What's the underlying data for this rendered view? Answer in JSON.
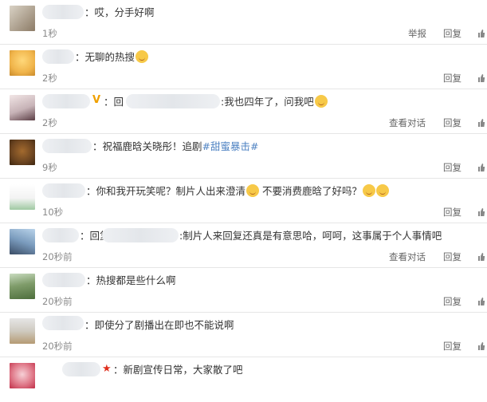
{
  "comments": [
    {
      "text": "：哎，分手好啊",
      "time": "1秒",
      "report": "举报",
      "reply": "回复"
    },
    {
      "text": "：无聊的热搜",
      "time": "2秒",
      "reply": "回复"
    },
    {
      "prefix": "：回",
      "text": ":我也四年了，问我吧",
      "time": "2秒",
      "view": "查看对话",
      "reply": "回复"
    },
    {
      "text": "：祝福鹿晗关晓彤！追剧",
      "hashtag": "#甜蜜暴击#",
      "time": "9秒",
      "reply": "回复"
    },
    {
      "text": "：你和我开玩笑呢？制片人出来澄清",
      "text2": "不要消费鹿晗了好吗？",
      "time": "10秒",
      "reply": "回复"
    },
    {
      "prefix": "：回复",
      "text": ":制片人来回复还真是有意思哈，呵呵，这事属于个人事情吧",
      "time": "20秒前",
      "view": "查看对话",
      "reply": "回复"
    },
    {
      "text": "：热搜都是些什么啊",
      "time": "20秒前",
      "reply": "回复"
    },
    {
      "text": "：即使分了剧播出在即也不能说啊",
      "time": "20秒前",
      "reply": "回复"
    },
    {
      "text": "：新剧宣传日常，大家散了吧"
    }
  ],
  "icons": {
    "thumb": "thumbs-up-icon",
    "emoji": "smiley-emoji-icon",
    "vip": "vip-badge-icon",
    "star": "star-badge-icon"
  },
  "colors": {
    "hashtag": "#4e82c2",
    "time": "#8a8a8a",
    "divider": "#e6e6e6"
  }
}
